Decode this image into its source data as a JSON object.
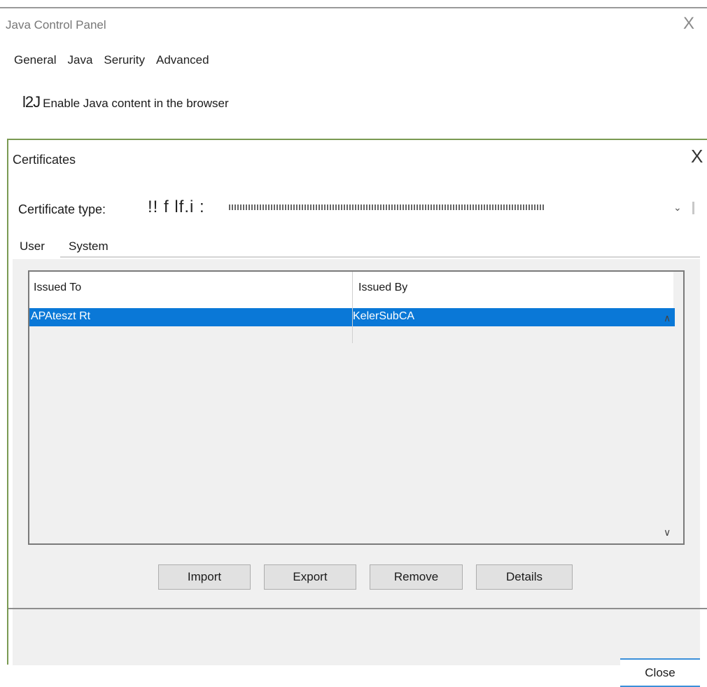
{
  "window": {
    "title": "Java Control Panel",
    "close_glyph": "X"
  },
  "tabs": [
    "General",
    "Java",
    "Serurity",
    "Advanced"
  ],
  "enable_row": {
    "checkbox_glyph": "l2J",
    "label": "Enable Java content in the browser"
  },
  "dialog": {
    "title": "Certificates",
    "close_glyph": "X",
    "certificate_type": {
      "label": "Certificate type:",
      "value": "!! f lf.i :"
    },
    "tabs": {
      "user": "User",
      "system": "System"
    },
    "table": {
      "columns": [
        "Issued To",
        "Issued By"
      ],
      "rows": [
        {
          "issued_to": "APAteszt Rt",
          "issued_by": "KelerSubCA",
          "selected": true
        }
      ]
    },
    "buttons": {
      "import": "Import",
      "export": "Export",
      "remove": "Remove",
      "details": "Details"
    },
    "close_button": "Close"
  },
  "icons": {
    "chevron_down": "⌄",
    "scroll_up": "∧",
    "scroll_down": "∨"
  },
  "colors": {
    "selection": "#0a78d7",
    "dialog_border": "#7a9a52",
    "close_accent": "#3b8fd9"
  }
}
